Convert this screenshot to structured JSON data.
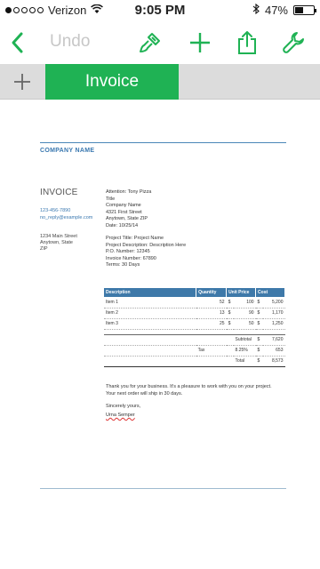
{
  "status_bar": {
    "carrier": "Verizon",
    "time": "9:05 PM",
    "battery_text": "47%",
    "battery_level": 0.47,
    "signal_bars_filled": 1,
    "signal_bars_total": 5
  },
  "toolbar": {
    "undo_label": "Undo",
    "accent_color": "#1fb254",
    "icons": [
      "back-chevron-icon",
      "paintbrush-icon",
      "plus-icon",
      "share-icon",
      "wrench-icon"
    ]
  },
  "tabs": {
    "active_label": "Invoice"
  },
  "document": {
    "company_name": "COMPANY NAME",
    "invoice_title": "INVOICE",
    "phone": "123-456-7890",
    "email": "no_reply@example.com",
    "address_lines": [
      "1234 Main Street",
      "Anytown, State",
      "ZIP"
    ],
    "attention_lines": [
      "Attention: Tony Pizza",
      "Title",
      "Company Name",
      "4321 First Street",
      "Anytown, State ZIP",
      "Date: 10/25/14"
    ],
    "project_lines": [
      "Project Title: Project Name",
      "Project Description: Description Here",
      "P.O. Number: 12345",
      "Invoice Number: 67890",
      "Terms: 30 Days"
    ],
    "table": {
      "headers": [
        "Description",
        "Quantity",
        "Unit Price",
        "Cost"
      ],
      "rows": [
        {
          "description": "Item 1",
          "quantity": "52",
          "currency": "$",
          "unit_price": "100",
          "currency2": "$",
          "cost": "5,200"
        },
        {
          "description": "Item 2",
          "quantity": "13",
          "currency": "$",
          "unit_price": "90",
          "currency2": "$",
          "cost": "1,170"
        },
        {
          "description": "Item 3",
          "quantity": "25",
          "currency": "$",
          "unit_price": "50",
          "currency2": "$",
          "cost": "1,250"
        }
      ],
      "subtotal_label": "Subtotal",
      "subtotal_currency": "$",
      "subtotal_value": "7,620",
      "tax_label": "Tax",
      "tax_rate": "8.25%",
      "tax_currency": "$",
      "tax_value": "653",
      "total_label": "Total",
      "total_currency": "$",
      "total_value": "8,573"
    },
    "closing_lines": [
      "Thank you for your business. It's a pleasure to work with you on your project.",
      "Your next order will ship in 30 days."
    ],
    "sincerely": "Sincerely yours,",
    "signature": "Urna Semper"
  }
}
